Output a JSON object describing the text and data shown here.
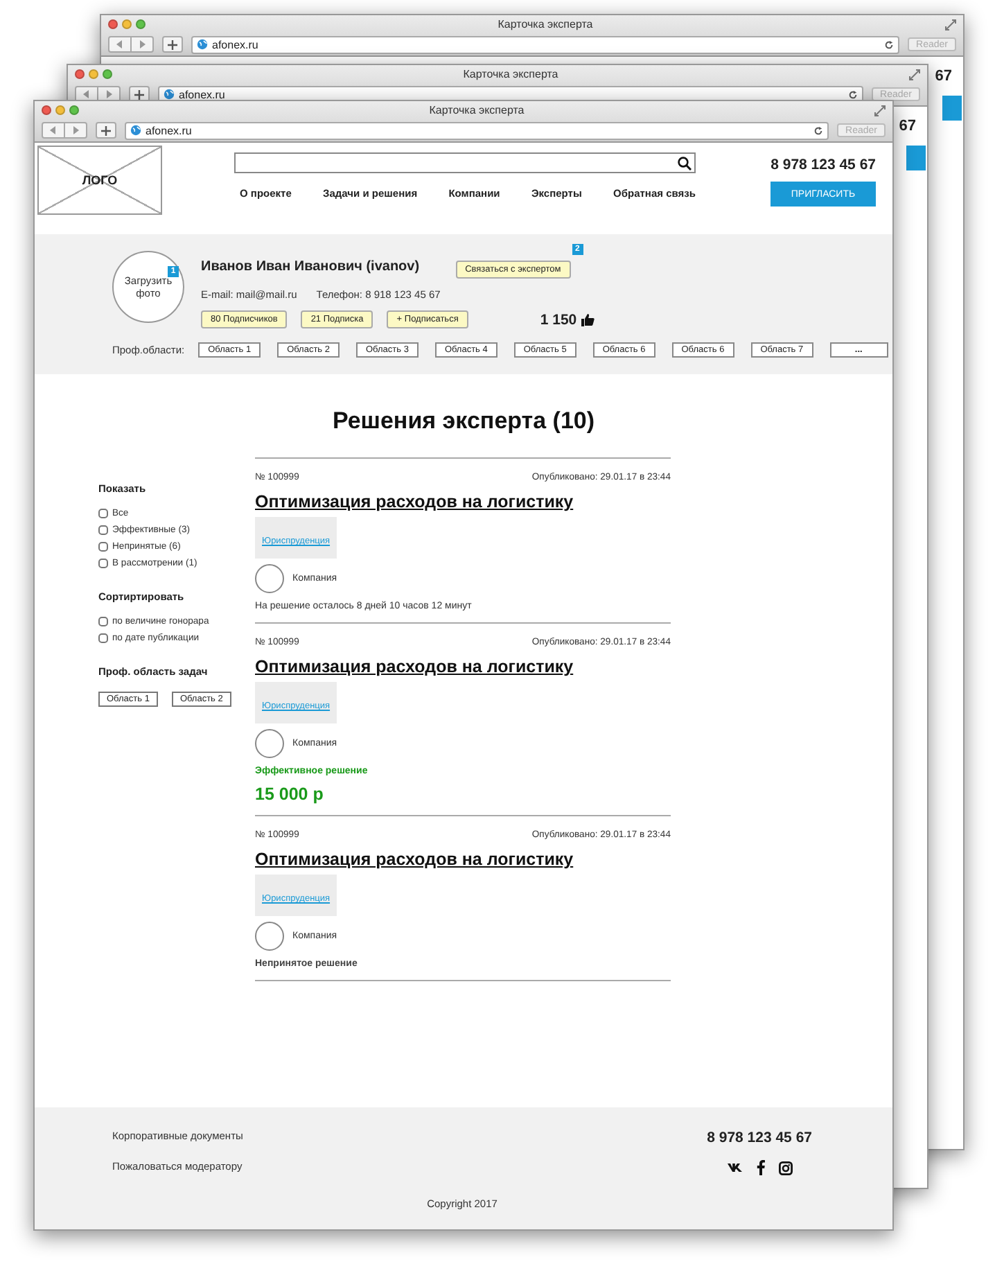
{
  "background_windows": [
    {
      "title": "Карточка эксперта",
      "address": "afonex.ru",
      "reader": "Reader",
      "phone_fragment": "67"
    },
    {
      "title": "Карточка эксперта",
      "address": "afonex.ru",
      "reader": "Reader",
      "phone_fragment": "67"
    }
  ],
  "window": {
    "title": "Карточка эксперта",
    "address": "afonex.ru",
    "reader": "Reader"
  },
  "header": {
    "logo": "ЛОГО",
    "phone": "8 978 123 45 67",
    "nav": [
      "О проекте",
      "Задачи и решения",
      "Компании",
      "Эксперты",
      "Обратная связь"
    ],
    "invite_button": "ПРИГЛАСИТЬ"
  },
  "profile": {
    "photo_label": "Загрузить фото",
    "photo_badge": "1",
    "name": "Иванов Иван Иванович (ivanov)",
    "contact_button": "Связаться с экспертом",
    "contact_badge": "2",
    "email": "E-mail: mail@mail.ru",
    "phone": "Телефон: 8 918 123 45 67",
    "buttons": [
      "80 Подписчиков",
      "21 Подписка",
      "+ Подписаться"
    ],
    "likes": "1 150",
    "areas_label": "Проф.области:",
    "areas": [
      "Область 1",
      "Область 2",
      "Область 3",
      "Область 4",
      "Область 5",
      "Область 6",
      "Область 6",
      "Область 7",
      "..."
    ]
  },
  "solutions_title": "Решения эксперта (10)",
  "filters": {
    "show": {
      "title": "Показать",
      "options": [
        {
          "label": "Все",
          "checked": false
        },
        {
          "label": "Эффективные (3)",
          "checked": false
        },
        {
          "label": "Непринятые (6)",
          "checked": false
        },
        {
          "label": "В рассмотрении (1)",
          "checked": false
        }
      ]
    },
    "sort": {
      "title": "Сортиртировать",
      "options": [
        {
          "label": "по величине гонорара",
          "checked": false
        },
        {
          "label": "по дате публикации",
          "checked": false
        }
      ]
    },
    "areas": {
      "title": "Проф. область задач",
      "tags": [
        "Область 1",
        "Область 2"
      ]
    }
  },
  "solutions": [
    {
      "kind": "pending",
      "number": "№ 100999",
      "published": "Опубликовано: 29.01.17 в 23:44",
      "title": "Оптимизация расходов на логистику",
      "category": "Юриспруденция",
      "company": "Компания",
      "status": "На решение осталось 8 дней 10 часов 12 минут"
    },
    {
      "kind": "effective",
      "number": "№ 100999",
      "published": "Опубликовано: 29.01.17 в 23:44",
      "title": "Оптимизация расходов на логистику",
      "category": "Юриспруденция",
      "company": "Компания",
      "status": "Эффективное решение",
      "price": "15 000 р"
    },
    {
      "kind": "rejected",
      "number": "№ 100999",
      "published": "Опубликовано: 29.01.17 в 23:44",
      "title": "Оптимизация расходов на логистику",
      "category": "Юриспруденция",
      "company": "Компания",
      "status": "Непринятое решение"
    }
  ],
  "footer": {
    "links": [
      "Корпоративные документы",
      "Пожаловаться модератору"
    ],
    "phone": "8 978 123 45 67",
    "copyright": "Copyright 2017"
  }
}
